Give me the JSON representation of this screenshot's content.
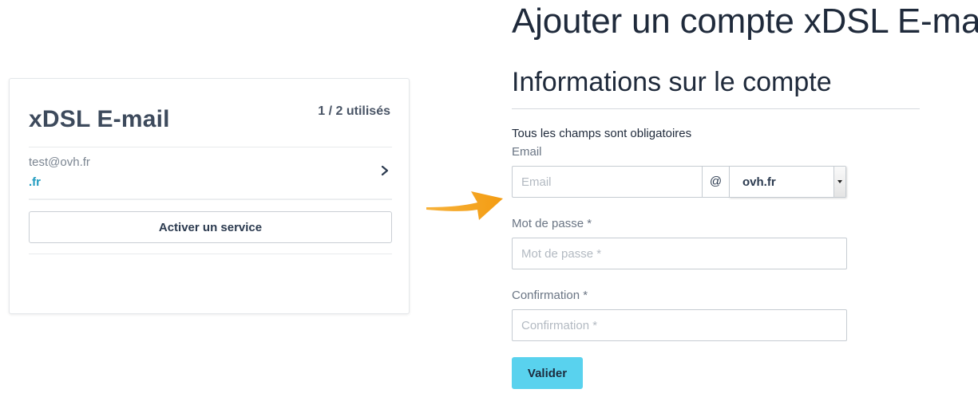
{
  "card": {
    "title": "xDSL E-mail",
    "usage": "1 / 2 utilisés",
    "account": {
      "email": "test@ovh.fr",
      "domain": ".fr",
      "icon": "chevron-right-icon"
    },
    "activate_label": "Activer un service"
  },
  "form": {
    "page_title": "Ajouter un compte xDSL E-mail",
    "section_title": "Informations sur le compte",
    "required_note": "Tous les champs sont obligatoires",
    "email": {
      "label": "Email",
      "placeholder": "Email",
      "at": "@",
      "domain_selected": "ovh.fr"
    },
    "password": {
      "label": "Mot de passe *",
      "placeholder": "Mot de passe *"
    },
    "confirmation": {
      "label": "Confirmation *",
      "placeholder": "Confirmation *"
    },
    "submit_label": "Valider"
  },
  "colors": {
    "accent": "#59d2ee",
    "link": "#1f9bbf",
    "arrow": "#f5a623",
    "text": "#2b3a4f"
  }
}
